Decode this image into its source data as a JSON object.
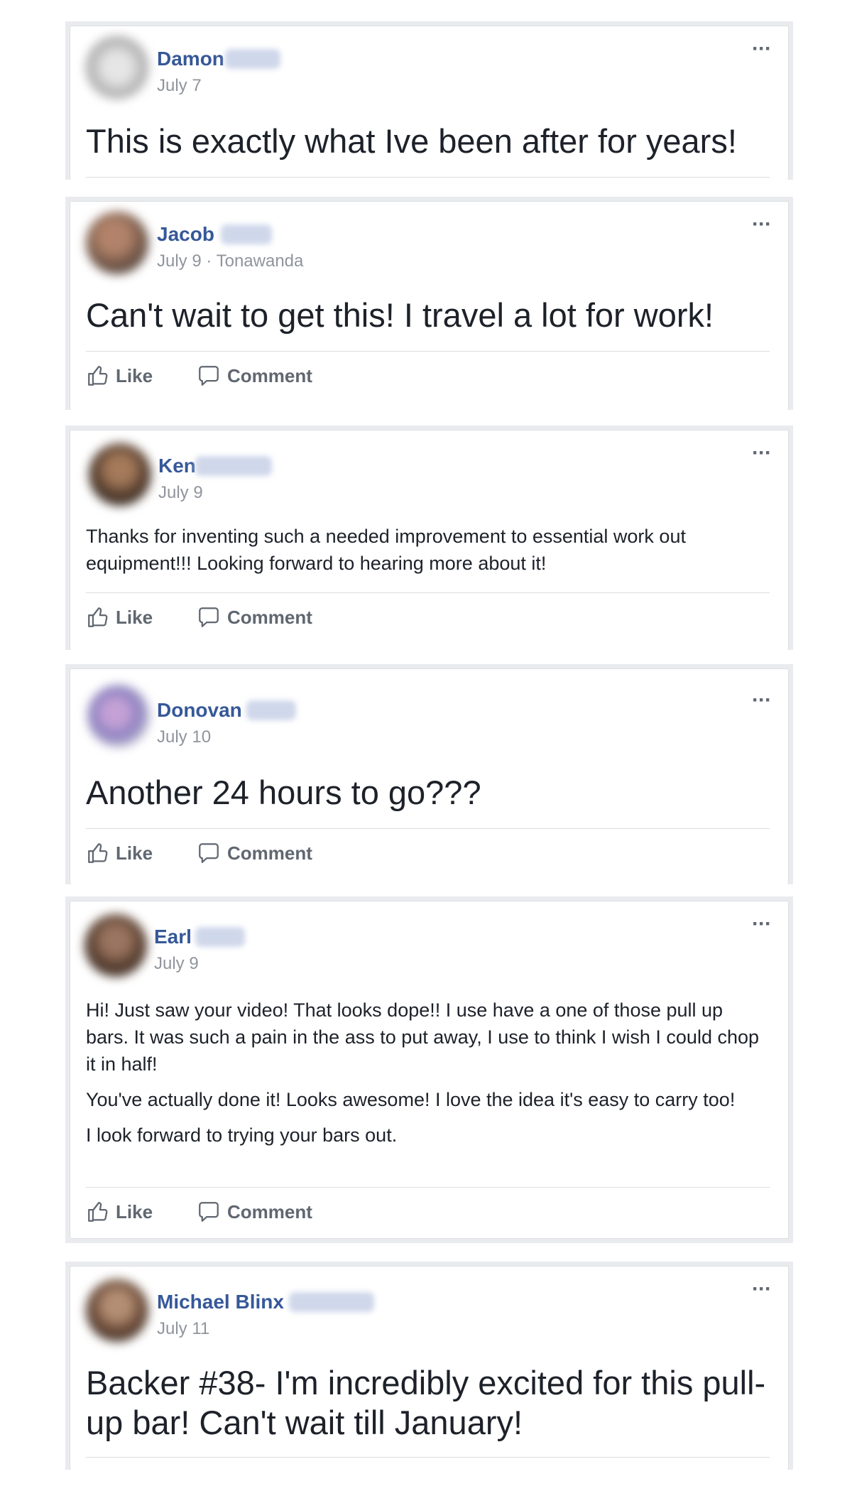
{
  "actions": {
    "like": "Like",
    "comment": "Comment"
  },
  "more_label": "···",
  "posts": [
    {
      "name": "Damon",
      "meta": "July 7",
      "text": "This is exactly what Ive been after for years!"
    },
    {
      "name": "Jacob",
      "meta": "July 9 · Tonawanda",
      "text": "Can't wait to get this! I travel a lot for work!"
    },
    {
      "name": "Ken",
      "meta": "July 9",
      "text": "Thanks for inventing such a needed improvement to essential work out equipment!!! Looking forward to hearing more about it!"
    },
    {
      "name": "Donovan",
      "meta": "July 10",
      "text": "Another 24 hours to go???"
    },
    {
      "name": "Earl",
      "meta": "July 9",
      "paragraphs": [
        "Hi! Just saw your video! That looks dope!! I use have a one of those pull up bars. It was such a pain in the ass to put away, I use to think I wish I could chop it in half!",
        "You've actually done it! Looks awesome! I love the idea it's easy to carry too!",
        "I look forward to trying your bars out."
      ]
    },
    {
      "name": "Michael Blinx",
      "meta": "July 11",
      "text": "Backer #38- I'm incredibly excited for this pull-up bar! Can't wait till January!"
    }
  ]
}
